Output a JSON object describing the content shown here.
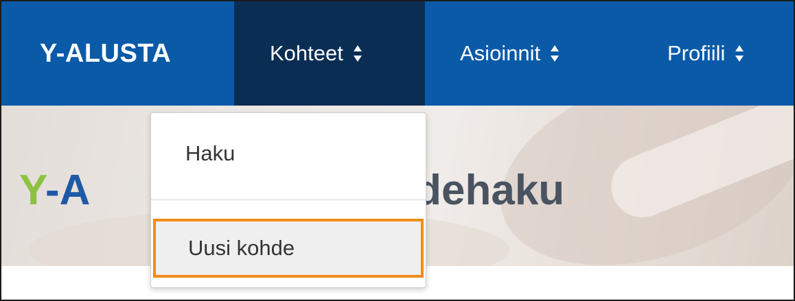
{
  "app": {
    "brand": "Y-ALUSTA"
  },
  "nav": {
    "items": [
      {
        "label": "Kohteet",
        "icon": "sort-updown-icon",
        "active": true
      },
      {
        "label": "Asioinnit",
        "icon": "sort-updown-icon",
        "active": false
      },
      {
        "label": "Profiili",
        "icon": "sort-updown-icon",
        "active": false
      }
    ]
  },
  "hero": {
    "title_y": "Y",
    "title_dash": "-",
    "title_a": "A",
    "title_rest": "ohdehaku"
  },
  "dropdown": {
    "items": [
      {
        "label": "Haku"
      },
      {
        "label": "Uusi kohde",
        "highlighted": true
      }
    ]
  },
  "colors": {
    "nav_background": "#0a5aa8",
    "nav_active": "#0a2d54",
    "highlight_border": "#f08c1a",
    "logo_green": "#8dc13f",
    "logo_blue": "#1e5aa6"
  }
}
